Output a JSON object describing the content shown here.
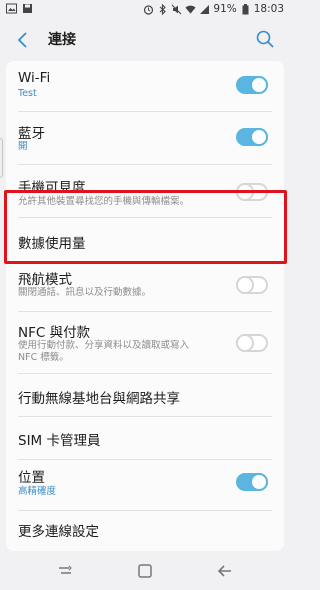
{
  "status_bar": {
    "battery_text": "91%",
    "time": "18:03",
    "left_icons": [
      "image-icon",
      "save-icon"
    ],
    "right_icons": [
      "alarm-icon",
      "bluetooth-icon",
      "mute-icon",
      "wifi-icon",
      "signal-icon",
      "battery-icon"
    ]
  },
  "app_bar": {
    "title": "連接"
  },
  "settings": [
    {
      "id": "wifi",
      "label": "Wi-Fi",
      "sub": "Test",
      "sub_style": "blue",
      "toggle": true
    },
    {
      "id": "bluetooth",
      "label": "藍牙",
      "sub": "開",
      "sub_style": "blue",
      "toggle": true
    },
    {
      "id": "visibility",
      "label": "手機可見度",
      "sub": "允許其他裝置尋找您的手機與傳輸檔案。",
      "sub_style": "gray",
      "toggle": false
    },
    {
      "id": "data-usage",
      "label": "數據使用量"
    },
    {
      "id": "airplane",
      "label": "飛航模式",
      "sub": "關閉通話、訊息以及行動數據。",
      "sub_style": "gray",
      "toggle": false
    },
    {
      "id": "nfc",
      "label": "NFC 與付款",
      "sub1": "使用行動付款、分享資料以及讀取或寫入",
      "sub2": "NFC 標籤。",
      "sub_style": "gray",
      "toggle": false
    },
    {
      "id": "hotspot",
      "label": "行動無線基地台與網路共享"
    },
    {
      "id": "sim",
      "label": "SIM 卡管理員"
    },
    {
      "id": "location",
      "label": "位置",
      "sub": "高精確度",
      "sub_style": "blue",
      "toggle": true
    },
    {
      "id": "more",
      "label": "更多連線設定"
    }
  ],
  "colors": {
    "accent": "#5ab6e0",
    "highlight": "#e0131a",
    "background": "#f1f1f3"
  },
  "nav_icons": [
    "recents-icon",
    "home-icon",
    "back-nav-icon"
  ]
}
